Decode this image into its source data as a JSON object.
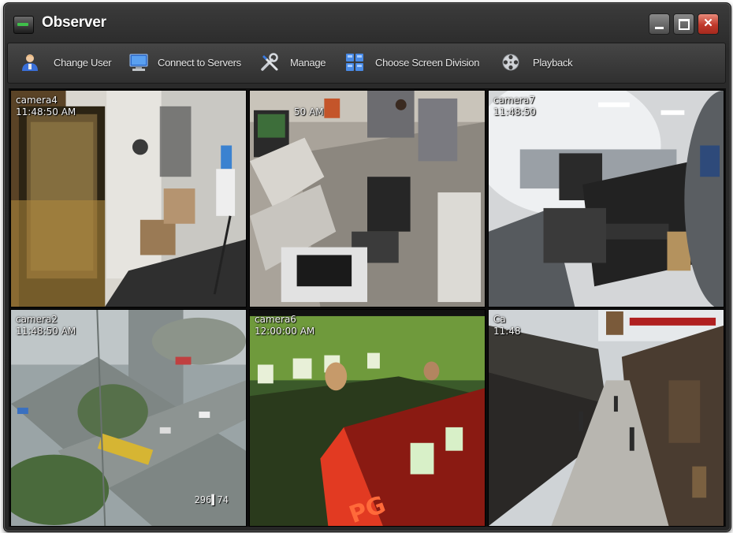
{
  "window": {
    "title": "Observer",
    "controls": {
      "minimize": "minimize",
      "maximize": "maximize",
      "close": "close"
    }
  },
  "toolbar": {
    "items": [
      {
        "label": "Change User",
        "icon": "user-icon"
      },
      {
        "label": "Connect to Servers",
        "icon": "monitor-server-icon"
      },
      {
        "label": "Manage",
        "icon": "tools-icon"
      },
      {
        "label": "Choose Screen Division",
        "icon": "grid-layout-icon"
      },
      {
        "label": "Playback",
        "icon": "film-reel-icon"
      }
    ]
  },
  "cameras": [
    {
      "label": "camera4",
      "time": "11:48:50 AM"
    },
    {
      "label": "",
      "time": "50 AM"
    },
    {
      "label": "camera7",
      "time": "11:48:50"
    },
    {
      "label": "camera2",
      "time": "11:48:50 AM"
    },
    {
      "label": "camera6",
      "time": "12:00:00 AM"
    },
    {
      "label": "Ca",
      "time": "11:48"
    }
  ],
  "overlays": {
    "camera2_counter": "296▌74"
  },
  "colors": {
    "window_bg": "#2a2a2a",
    "toolbar_bg": "#3a3a3a",
    "close_red": "#c0392b",
    "text": "#ffffff"
  }
}
